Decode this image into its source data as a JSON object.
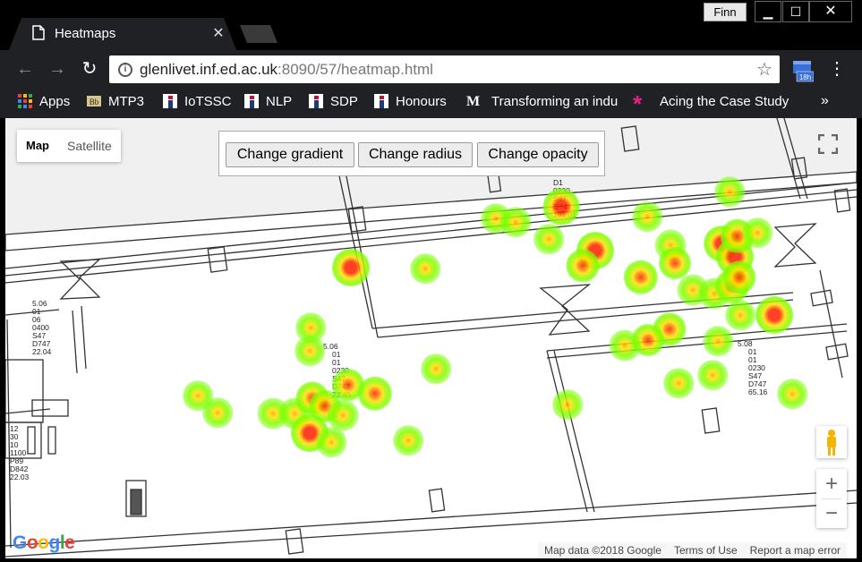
{
  "browser": {
    "tab_title": "Heatmaps",
    "profile_name": "Finn",
    "url_host": "glenlivet.inf.ed.ac.uk",
    "url_rest": ":8090/57/heatmap.html",
    "extension_badge": "18h"
  },
  "bookmarks": [
    {
      "label": "Apps",
      "icon": "apps-grid-icon"
    },
    {
      "label": "MTP3",
      "icon": "blackboard-icon"
    },
    {
      "label": "IoTSSC",
      "icon": "info-i-icon"
    },
    {
      "label": "NLP",
      "icon": "info-i-icon"
    },
    {
      "label": "SDP",
      "icon": "info-i-icon"
    },
    {
      "label": "Honours",
      "icon": "info-i-icon"
    },
    {
      "label": "Transforming an indu",
      "icon": "medium-m-icon"
    },
    {
      "label": "Acing the Case Study",
      "icon": "asterisk-icon"
    }
  ],
  "map": {
    "type_active": "Map",
    "type_inactive": "Satellite",
    "controls": {
      "gradient": "Change gradient",
      "radius": "Change radius",
      "opacity": "Change opacity"
    },
    "google_logo": "Google",
    "attribution": {
      "data": "Map data ©2018 Google",
      "terms": "Terms of Use",
      "report": "Report a map error"
    },
    "zoom_in": "+",
    "zoom_out": "−"
  },
  "colors": {
    "heat_low": "#7cff00",
    "heat_mid": "#ffe000",
    "heat_high": "#ff2000",
    "browser_chrome": "#202124"
  }
}
